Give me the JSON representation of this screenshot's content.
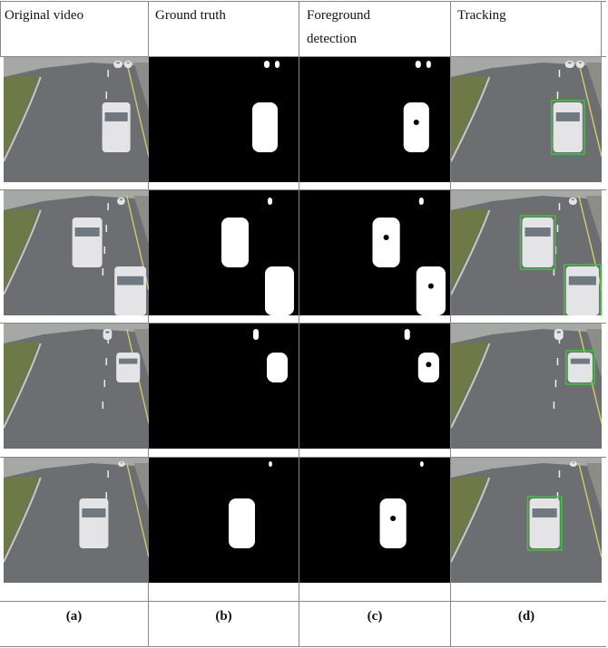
{
  "headers": [
    "Original video",
    "Ground truth",
    "Foreground detection",
    "Tracking"
  ],
  "labels": [
    "(a)",
    "(b)",
    "(c)",
    "(d)"
  ],
  "colors": {
    "grid": "#888888",
    "tracking_box": "#33cc33",
    "mask_bg": "#000000",
    "mask_fg": "#ffffff"
  },
  "rows": 4
}
